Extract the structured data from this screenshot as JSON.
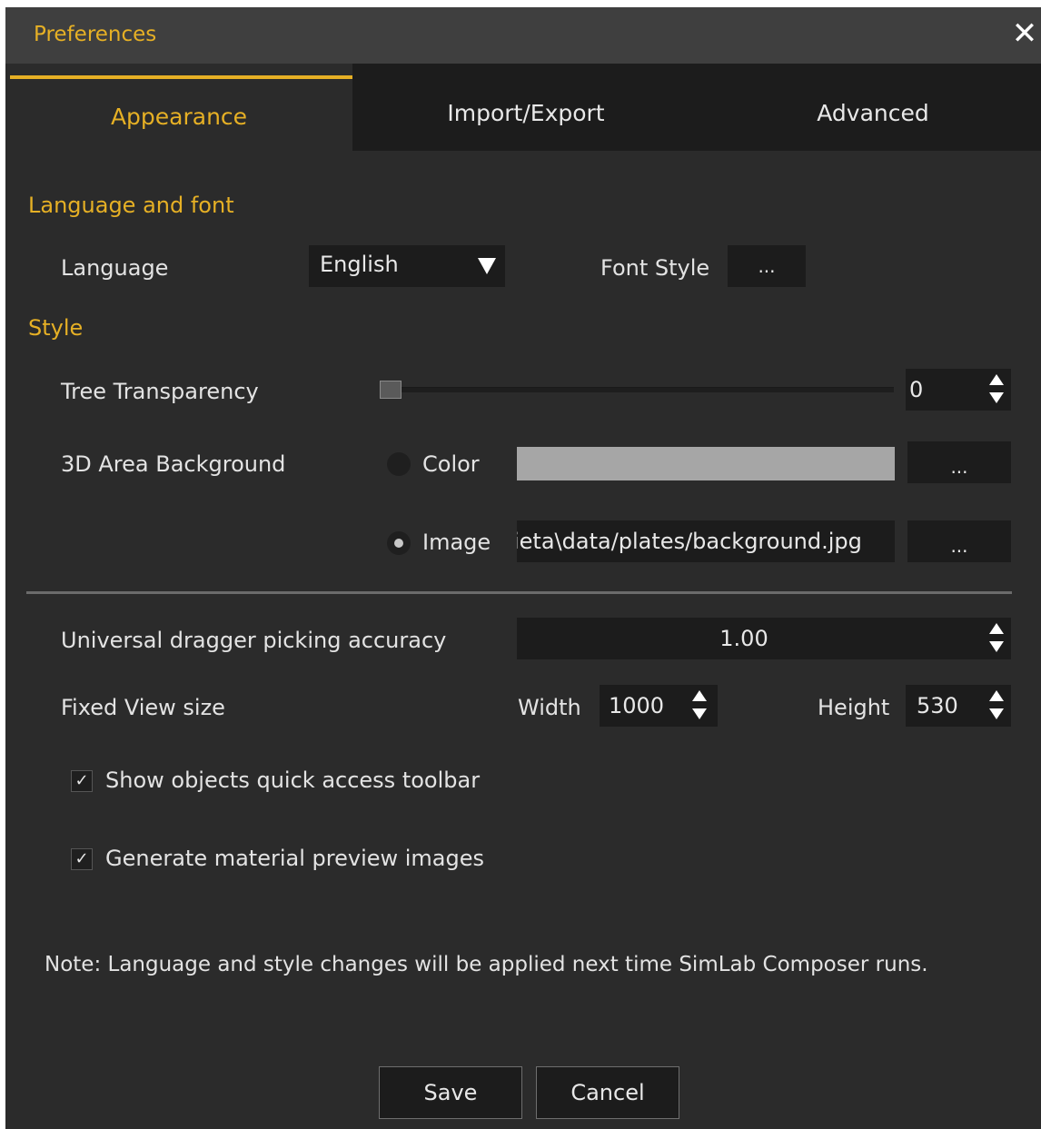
{
  "window": {
    "title": "Preferences",
    "close_icon": "close-icon"
  },
  "tabs": [
    {
      "label": "Appearance",
      "active": true
    },
    {
      "label": "Import/Export",
      "active": false
    },
    {
      "label": "Advanced",
      "active": false
    }
  ],
  "language_font": {
    "section_title": "Language and font",
    "language_label": "Language",
    "language_value": "English",
    "dropdown_icon": "triangle-down-icon",
    "font_style_label": "Font Style",
    "font_style_button": "..."
  },
  "style": {
    "section_title": "Style",
    "tree_transparency_label": "Tree Transparency",
    "tree_transparency_value": "0",
    "background_label": "3D Area Background",
    "color_option_label": "Color",
    "color_swatch": "#a6a6a6",
    "color_button": "...",
    "image_option_label": "Image",
    "image_path": "ieta\\data/plates/background.jpg",
    "image_button": "...",
    "selected_background": "Image"
  },
  "misc": {
    "dragger_label": "Universal dragger picking accuracy",
    "dragger_value": "1.00",
    "fixed_view_label": "Fixed View size",
    "width_label": "Width",
    "width_value": "1000",
    "height_label": "Height",
    "height_value": "530",
    "show_toolbar_label": "Show objects quick access toolbar",
    "show_toolbar_checked": true,
    "material_preview_label": "Generate material preview images",
    "material_preview_checked": true,
    "check_glyph": "✓"
  },
  "note": "Note: Language and style changes will be applied next time SimLab Composer runs.",
  "buttons": {
    "save": "Save",
    "cancel": "Cancel"
  },
  "colors": {
    "accent": "#e6b025",
    "background": "#2b2b2b",
    "field": "#1c1c1c"
  }
}
